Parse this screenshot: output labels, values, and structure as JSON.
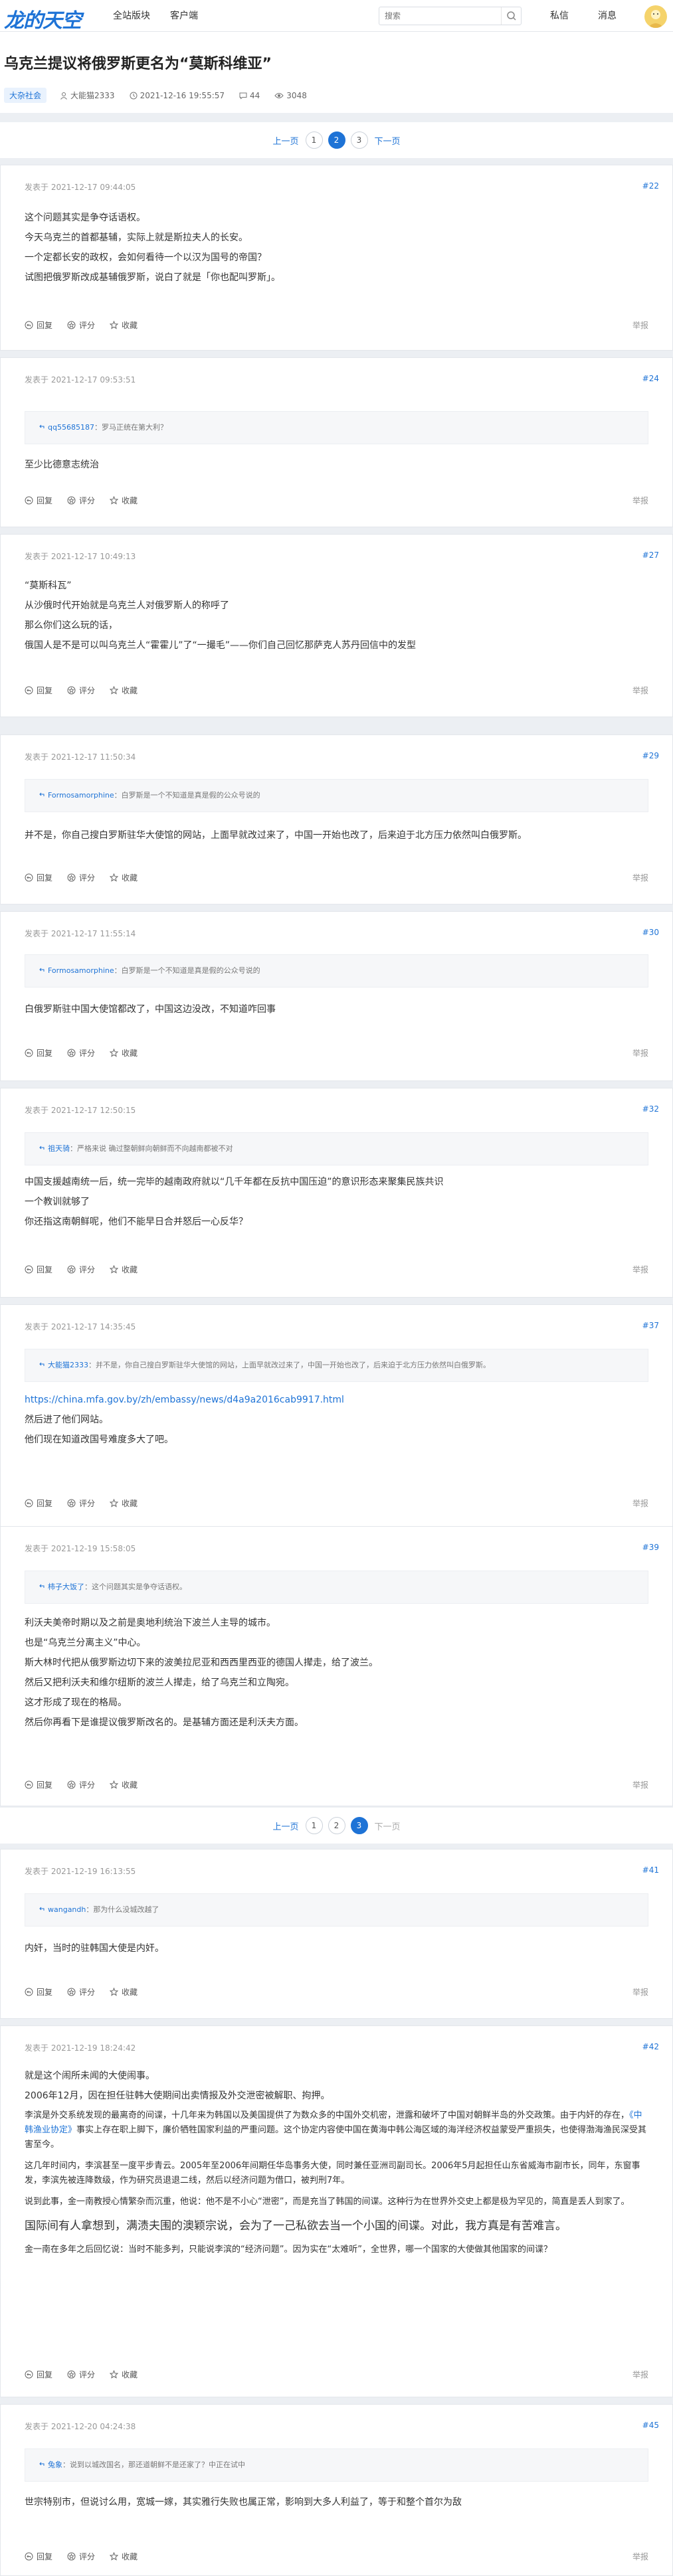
{
  "site": {
    "logo": "龙的天空",
    "nav": [
      "全站版块",
      "客户端"
    ],
    "search_placeholder": "搜索",
    "user_nav": [
      "私信",
      "消息"
    ]
  },
  "thread": {
    "title": "乌克兰提议将俄罗斯更名为“莫斯科维亚”",
    "board": "大杂社会",
    "author": "大能猫2333",
    "time": "2021-12-16 19:55:57",
    "comments": "44",
    "views": "3048"
  },
  "pagination": {
    "prev": "上一页",
    "next": "下一页",
    "pages": [
      "1",
      "2",
      "3"
    ]
  },
  "actions": {
    "reply": "回复",
    "rate": "评分",
    "fav": "收藏",
    "report": "举报"
  },
  "posts": [
    {
      "time": "发表于 2021-12-17 09:44:05",
      "floor": "#22",
      "lines": [
        "这个问题其实是争夺话语权。",
        "今天乌克兰的首都基辅，实际上就是斯拉夫人的长安。",
        "一个定都长安的政权，会如何看待一个以汉为国号的帝国？",
        "试图把俄罗斯改成基辅俄罗斯，说白了就是「你也配叫罗斯」。"
      ]
    },
    {
      "time": "发表于 2021-12-17 09:53:51",
      "floor": "#24",
      "quote_user": "qq55685187",
      "quote_text": "：罗马正统在第大利？",
      "lines": [
        "至少比德意志统治"
      ]
    },
    {
      "time": "发表于 2021-12-17 10:49:13",
      "floor": "#27",
      "lines": [
        "“莫斯科瓦”",
        "从沙俄时代开始就是乌克兰人对俄罗斯人的称呼了",
        "那么你们这么玩的话，",
        "俄国人是不是可以叫乌克兰人“霍霍儿”了“一撮毛”——你们自己回忆那萨克人苏丹回信中的发型"
      ]
    },
    {
      "time": "发表于 2021-12-17 11:50:34",
      "floor": "#29",
      "quote_user": "Formosamorphine",
      "quote_text": "：白罗斯是一个不知道是真是假的公众号说的",
      "lines": [
        "并不是，你自己搜白罗斯驻华大使馆的网站，上面早就改过来了，中国一开始也改了，后来迫于北方压力依然叫白俄罗斯。"
      ]
    },
    {
      "time": "发表于 2021-12-17 11:55:14",
      "floor": "#30",
      "quote_user": "Formosamorphine",
      "quote_text": "：白罗斯是一个不知道是真是假的公众号说的",
      "lines": [
        "白俄罗斯驻中国大使馆都改了，中国这边没改，不知道咋回事"
      ]
    },
    {
      "time": "发表于 2021-12-17 12:50:15",
      "floor": "#32",
      "quote_user": "祖天骑",
      "quote_text": "：严格来说 确过整朝鲜向朝鲜而不向越南都被不对",
      "lines": [
        "中国支援越南统一后，统一完毕的越南政府就以“几千年都在反抗中国压迫”的意识形态来聚集民族共识",
        "一个教训就够了",
        "你还指这南朝鲜呢，他们不能早日合并怒后一心反华？"
      ]
    },
    {
      "time": "发表于 2021-12-17 14:35:45",
      "floor": "#37",
      "quote_user": "大能猫2333",
      "quote_text": "：并不是，你自己搜白罗斯驻华大使馆的网站，上面早就改过来了，中国一开始也改了，后来迫于北方压力依然叫白俄罗斯。",
      "link": "https://china.mfa.gov.by/zh/embassy/news/d4a9a2016cab9917.html",
      "lines": [
        "然后进了他们网站。",
        "他们现在知道改国号难度多大了吧。"
      ]
    },
    {
      "time": "发表于 2021-12-19 15:58:05",
      "floor": "#39",
      "quote_user": "柿子大饭了",
      "quote_text": "：这个问题其实是争夺话语权。",
      "lines": [
        "利沃夫美帝时期以及之前是奥地利统治下波兰人主导的城市。",
        "也是“乌克兰分离主义”中心。",
        "斯大林时代把从俄罗斯边切下来的波美拉尼亚和西西里西亚的德国人撵走，给了波兰。",
        "然后又把利沃夫和维尔纽斯的波兰人撵走，给了乌克兰和立陶宛。",
        "这才形成了现在的格局。",
        "然后你再看下是谁提议俄罗斯改名的。是基辅方面还是利沃夫方面。"
      ]
    },
    {
      "time": "发表于 2021-12-19 16:13:55",
      "floor": "#41",
      "quote_user": "wangandh",
      "quote_text": "：那为什么没城改越了",
      "lines": [
        "内奸，当时的驻韩国大使是内奸。"
      ]
    },
    {
      "time": "发表于 2021-12-19 18:24:42",
      "floor": "#42",
      "p1": "就是这个闹所未闻的大使闹事。",
      "p2": "2006年12月，因在担任驻韩大使期间出卖情报及外交泄密被解职、拘押。",
      "p3a": "李滨是外交系统发现的最离奇的间谍，十几年来为韩国以及美国提供了为数众多的中国外交机密，泄露和破坏了中国对朝鲜半岛的外交政策。由于内奸的存在，",
      "p3link": "《中韩渔业协定》",
      "p3b": "事实上存在职上脚下，廉价牺牲国家利益的严重问题。这个协定内容使中国在黄海中韩公海区域的海洋经济权益蒙受严重损失，也使得渤海渔民深受其害至今。",
      "p4": "这几年时间内，李滨甚至一度平步青云。2005年至2006年间期任华岛事务大使，同时兼任亚洲司副司长。2006年5月起担任山东省威海市副市长，同年，东窗事发，李滨先被连降数级，作为研究员退退二线，然后以经济问题为借口，被判刑7年。",
      "p5": "说到此事，金一南教授心情繁杂而沉重，他说：他不是不小心“泄密”，而是充当了韩国的间谍。这种行为在世界外交史上都是极为罕见的，简直是丢人到家了。",
      "p6": "国际间有人拿想到，满渍夫围的澳颖宗说，会为了一己私欲去当一个小国的间谍。对此，我方真是有苦难言。",
      "p7": "金一南在多年之后回忆说：当时不能多判，只能说李滨的“经济问题”。因为实在“太难听”，全世界，哪一个国家的大使做其他国家的间谍？"
    },
    {
      "time": "发表于 2021-12-20 04:24:38",
      "floor": "#45",
      "quote_user": "兔象",
      "quote_text": "：说到以城改国名，那还道朝鲜不是还家了？中正在试中",
      "lines": [
        "世宗特别市，但说讨么用，宽城一嫁，其实雅行失败也属正常，影响到大多人利益了，等于和整个首尔为敌"
      ]
    }
  ]
}
